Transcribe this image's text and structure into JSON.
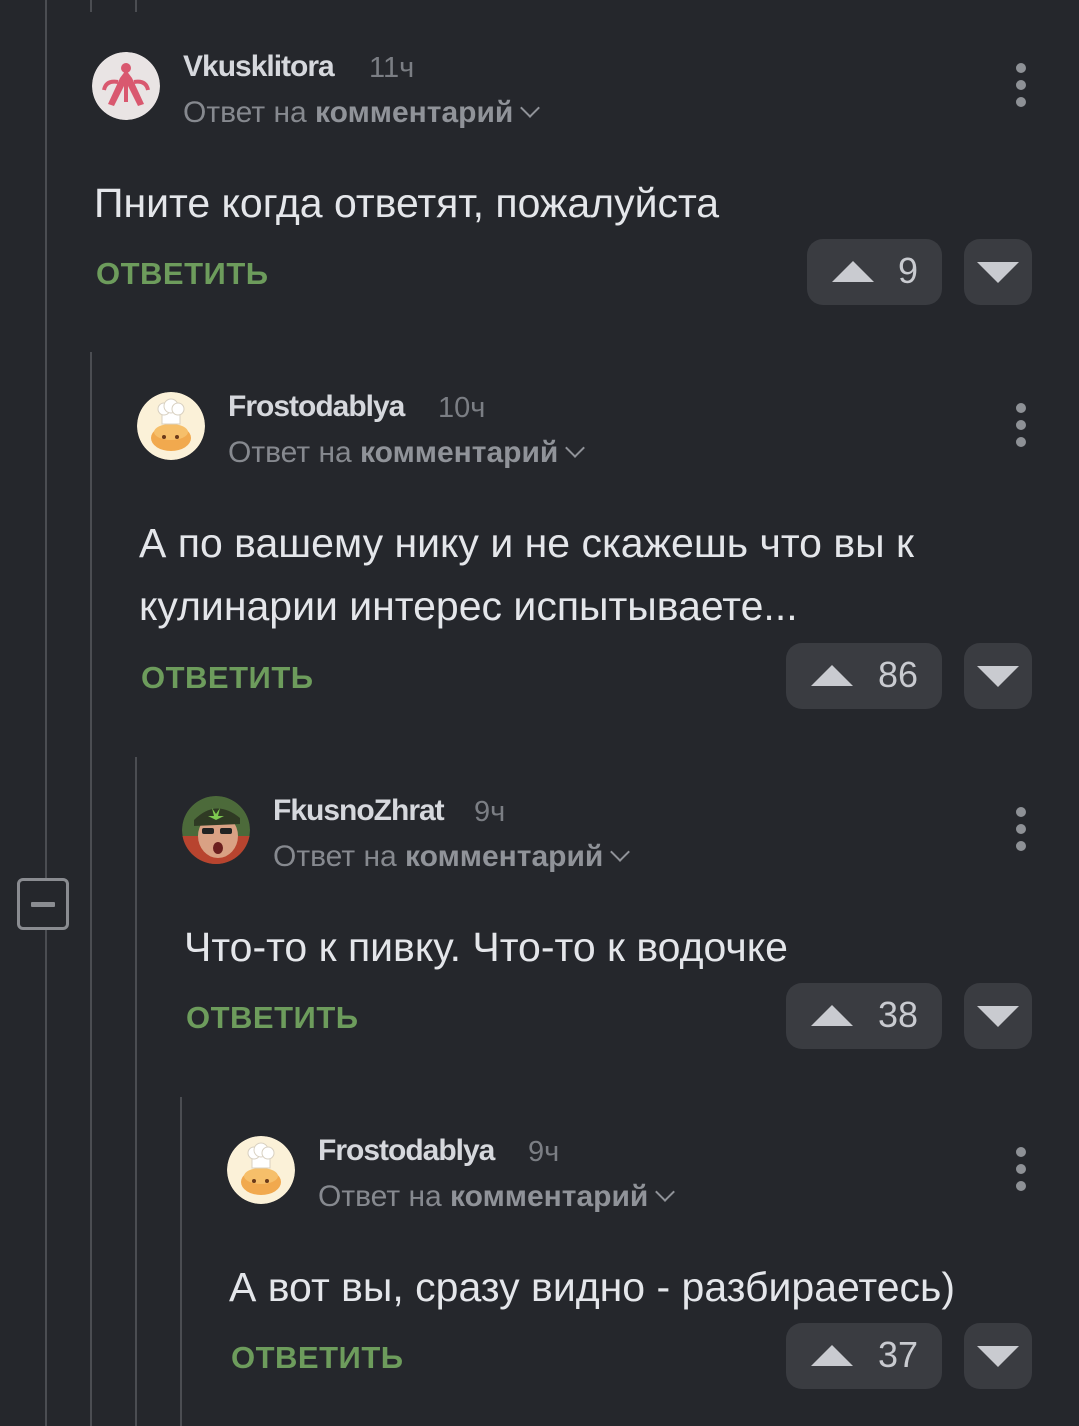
{
  "thread": {
    "collapse_label": "−",
    "comments": [
      {
        "username": "Vkusklitora",
        "time": "11ч",
        "reply_prefix": "Ответ на",
        "reply_target": "комментарий",
        "text": [
          "Пните когда ответят, пожалуйста"
        ],
        "reply_label": "ОТВЕТИТЬ",
        "rating": "9",
        "avatar": "pink-symbol-avatar"
      },
      {
        "username": "Frostodablya",
        "time": "10ч",
        "reply_prefix": "Ответ на",
        "reply_target": "комментарий",
        "text": [
          "А по вашему нику и не скажешь что вы к",
          "кулинарии интерес испытываете..."
        ],
        "reply_label": "ОТВЕТИТЬ",
        "rating": "86",
        "avatar": "chef-bun-avatar"
      },
      {
        "username": "FkusnoZhrat",
        "time": "9ч",
        "reply_prefix": "Ответ на",
        "reply_target": "комментарий",
        "text": [
          "Что-то к пивку. Что-то к водочке"
        ],
        "reply_label": "ОТВЕТИТЬ",
        "rating": "38",
        "avatar": "man-with-cap-avatar"
      },
      {
        "username": "Frostodablya",
        "time": "9ч",
        "reply_prefix": "Ответ на",
        "reply_target": "комментарий",
        "text": [
          "А вот вы, сразу видно - разбираетесь)"
        ],
        "reply_label": "ОТВЕТИТЬ",
        "rating": "37",
        "avatar": "chef-bun-avatar"
      }
    ]
  },
  "colors": {
    "background": "#25272c",
    "reply_green": "#6d9c5c",
    "thread_line": "#4b4d52",
    "vote_button": "#3a3c41"
  }
}
